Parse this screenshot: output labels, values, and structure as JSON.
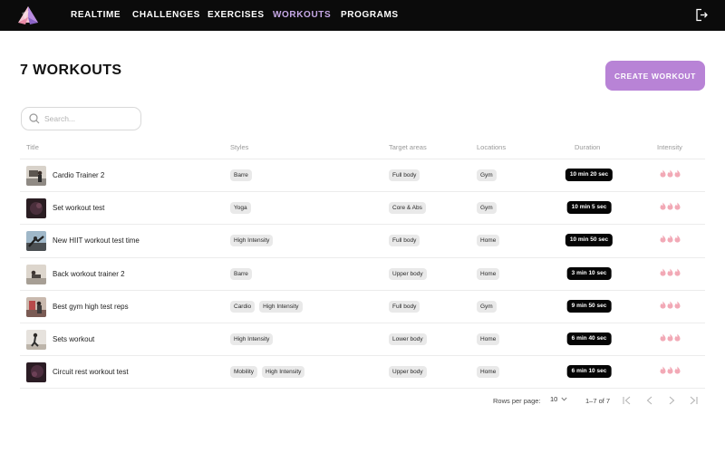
{
  "nav": {
    "links": [
      {
        "label": "REALTIME",
        "active": false
      },
      {
        "label": "CHALLENGES",
        "active": false
      },
      {
        "label": "EXERCISES",
        "active": false
      },
      {
        "label": "WORKOUTS",
        "active": true
      },
      {
        "label": "PROGRAMS",
        "active": false
      }
    ],
    "active_color": "#c6a8e6",
    "logout_icon": "logout-icon"
  },
  "header": {
    "title": "7 WORKOUTS",
    "create_button": "CREATE WORKOUT",
    "accent_color": "#b883d6"
  },
  "search": {
    "placeholder": "Search...",
    "value": ""
  },
  "table": {
    "columns": [
      "Title",
      "Styles",
      "Target areas",
      "Locations",
      "Duration",
      "Intensity"
    ],
    "rows": [
      {
        "title": "Cardio Trainer 2",
        "styles": [
          "Barre"
        ],
        "target": "Full body",
        "location": "Gym",
        "duration": "10 min 20 sec",
        "intensity": 3
      },
      {
        "title": "Set workout test",
        "styles": [
          "Yoga"
        ],
        "target": "Core & Abs",
        "location": "Gym",
        "duration": "10 min 5 sec",
        "intensity": 3
      },
      {
        "title": "New HIIT workout test time",
        "styles": [
          "High Intensity"
        ],
        "target": "Full body",
        "location": "Home",
        "duration": "10 min 50 sec",
        "intensity": 3
      },
      {
        "title": "Back workout trainer 2",
        "styles": [
          "Barre"
        ],
        "target": "Upper body",
        "location": "Home",
        "duration": "3 min 10 sec",
        "intensity": 3
      },
      {
        "title": "Best gym high test reps",
        "styles": [
          "Cardio",
          "High Intensity"
        ],
        "target": "Full body",
        "location": "Gym",
        "duration": "9 min 50 sec",
        "intensity": 3
      },
      {
        "title": "Sets workout",
        "styles": [
          "High Intensity"
        ],
        "target": "Lower body",
        "location": "Home",
        "duration": "6 min 40 sec",
        "intensity": 3
      },
      {
        "title": "Circuit rest workout test",
        "styles": [
          "Mobility",
          "High Intensity"
        ],
        "target": "Upper body",
        "location": "Home",
        "duration": "6 min 10 sec",
        "intensity": 3
      }
    ],
    "flame_color": "#f2a9b6"
  },
  "pagination": {
    "rows_per_page_label": "Rows per page:",
    "rows_per_page": "10",
    "range": "1–7 of 7"
  }
}
